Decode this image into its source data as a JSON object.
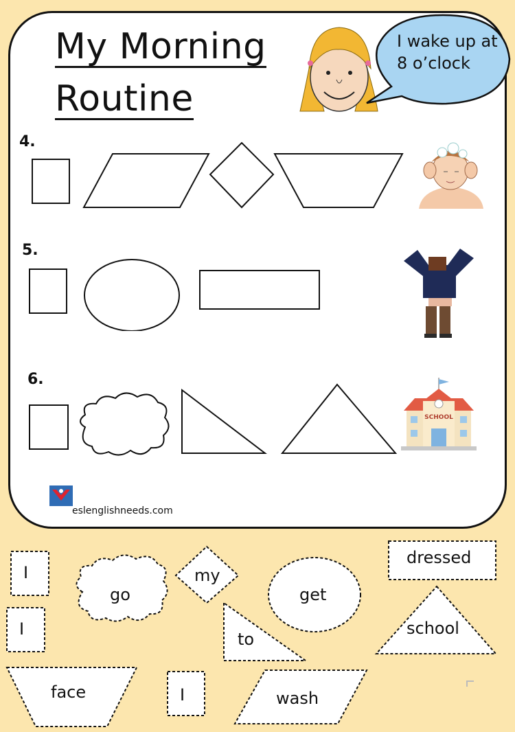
{
  "title_line1": "My Morning",
  "title_line2": "Routine",
  "speech": "I wake up at 8 o’clock",
  "numbers": [
    "4.",
    "5.",
    "6."
  ],
  "website": "eslenglishneeds.com",
  "pictures": [
    "girl-face",
    "washing-face",
    "getting-dressed",
    "school-building"
  ],
  "word_cards": {
    "i1": "I",
    "go": "go",
    "my": "my",
    "get": "get",
    "dressed": "dressed",
    "i2": "I",
    "to": "to",
    "school": "school",
    "face": "face",
    "i3": "I",
    "wash": "wash"
  },
  "school_sign": "SCHOOL"
}
